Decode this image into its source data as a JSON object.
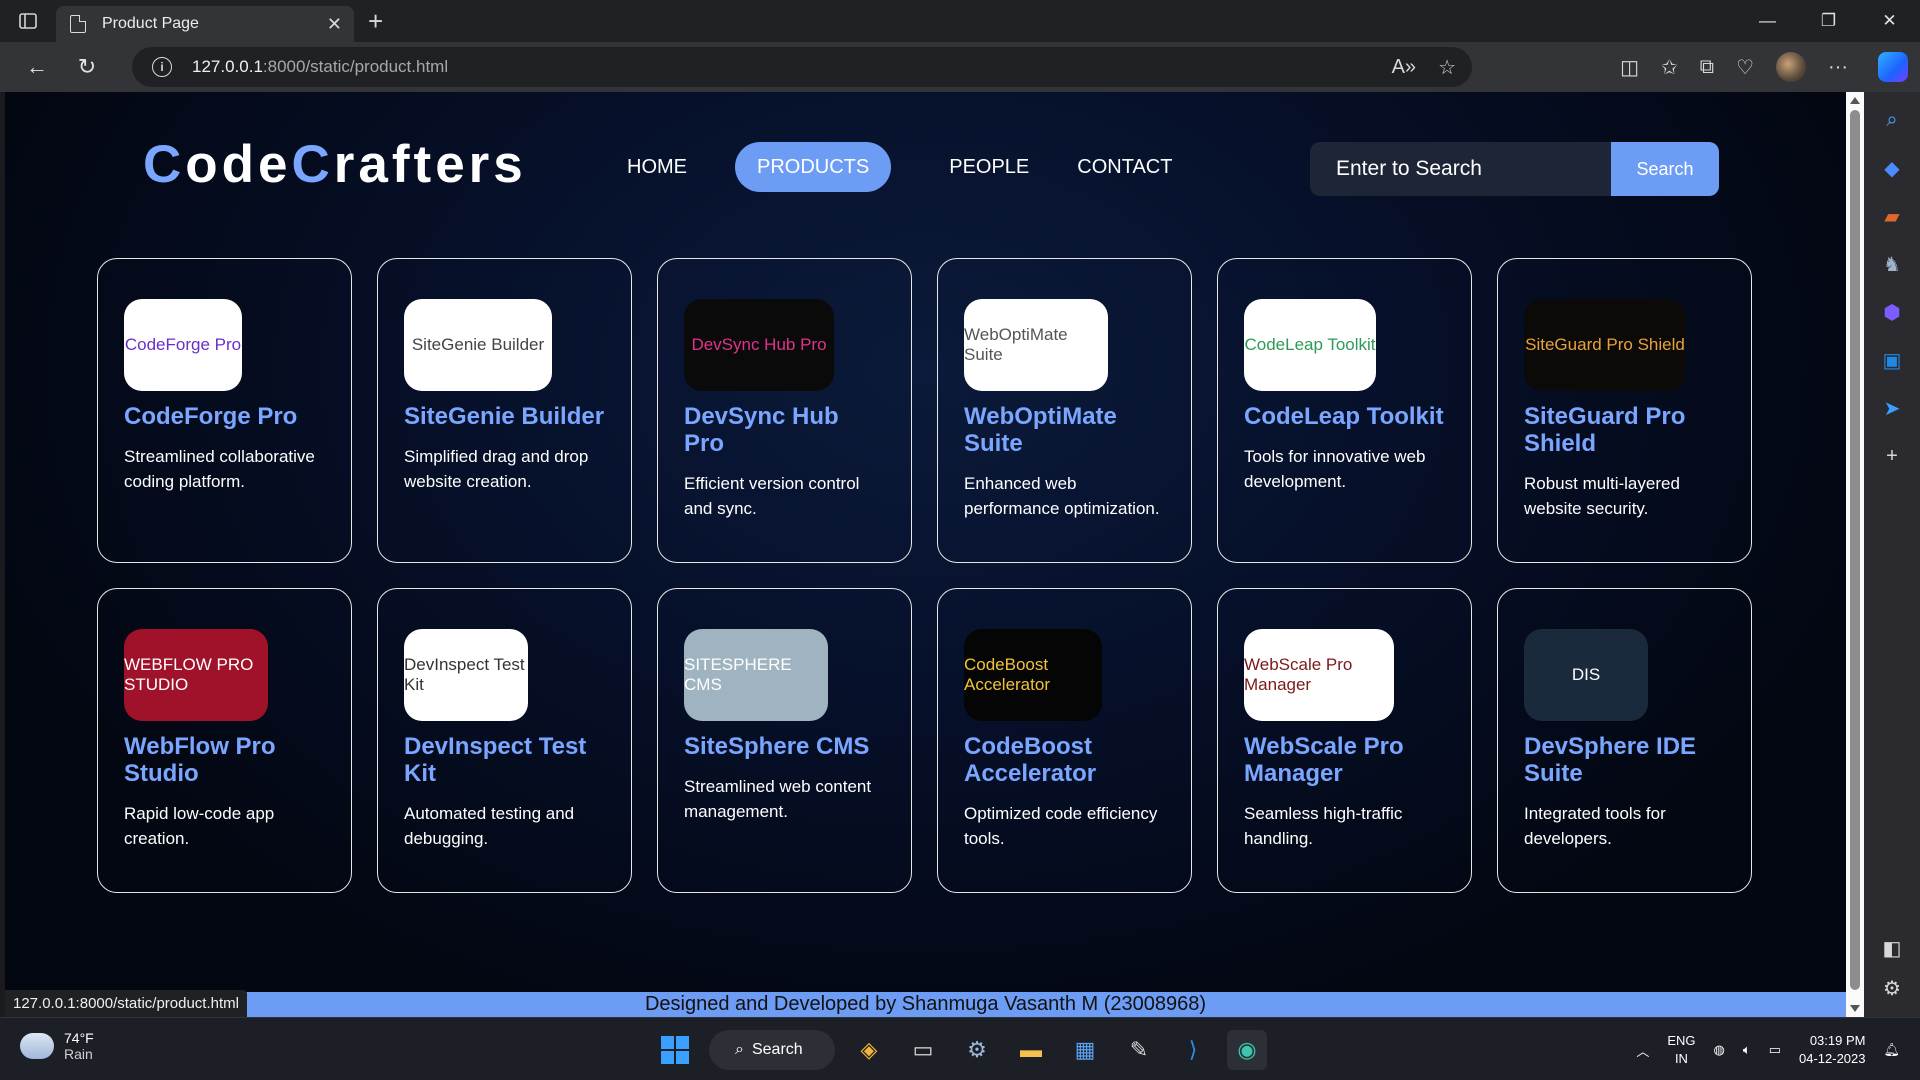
{
  "browser": {
    "tab_title": "Product Page",
    "url_host": "127.0.0.1",
    "url_rest": ":8000/static/product.html",
    "status_url": "127.0.0.1:8000/static/product.html"
  },
  "site": {
    "logo_parts": [
      "C",
      "ode",
      "C",
      "rafters"
    ],
    "nav": [
      {
        "label": "HOME",
        "active": false
      },
      {
        "label": "PRODUCTS",
        "active": true
      },
      {
        "label": "PEOPLE",
        "active": false
      },
      {
        "label": "CONTACT",
        "active": false
      }
    ],
    "search_placeholder": "Enter to Search",
    "search_button": "Search",
    "footer": "Designed and Developed by Shanmuga Vasanth M (23008968)"
  },
  "products": [
    {
      "name": "CodeForge Pro",
      "desc": "Streamlined collaborative coding platform.",
      "logo_text": "CodeForge Pro",
      "logo_bg": "#ffffff",
      "logo_fg": "#6b2fc9",
      "logo_w": 118
    },
    {
      "name": "SiteGenie Builder",
      "desc": "Simplified drag and drop website creation.",
      "logo_text": "SiteGenie Builder",
      "logo_bg": "#ffffff",
      "logo_fg": "#444444",
      "logo_w": 148
    },
    {
      "name": "DevSync Hub Pro",
      "desc": "Efficient version control and sync.",
      "logo_text": "DevSync Hub Pro",
      "logo_bg": "#0a0a0a",
      "logo_fg": "#e0338a",
      "logo_w": 150
    },
    {
      "name": "WebOptiMate Suite",
      "desc": "Enhanced web performance optimization.",
      "logo_text": "WebOptiMate Suite",
      "logo_bg": "#ffffff",
      "logo_fg": "#555555",
      "logo_w": 144
    },
    {
      "name": "CodeLeap Toolkit",
      "desc": "Tools for innovative web development.",
      "logo_text": "CodeLeap Toolkit",
      "logo_bg": "#ffffff",
      "logo_fg": "#2e9a5a",
      "logo_w": 132
    },
    {
      "name": "SiteGuard Pro Shield",
      "desc": "Robust multi-layered website security.",
      "logo_text": "SiteGuard Pro Shield",
      "logo_bg": "#0c0a08",
      "logo_fg": "#e8a13c",
      "logo_w": 162
    },
    {
      "name": "WebFlow Pro Studio",
      "desc": "Rapid low-code app creation.",
      "logo_text": "WEBFLOW PRO STUDIO",
      "logo_bg": "#a0122a",
      "logo_fg": "#ffffff",
      "logo_w": 144
    },
    {
      "name": "DevInspect Test Kit",
      "desc": "Automated testing and debugging.",
      "logo_text": "DevInspect Test Kit",
      "logo_bg": "#ffffff",
      "logo_fg": "#333333",
      "logo_w": 124
    },
    {
      "name": "SiteSphere CMS",
      "desc": "Streamlined web content management.",
      "logo_text": "SITESPHERE CMS",
      "logo_bg": "#9fb4c0",
      "logo_fg": "#ffffff",
      "logo_w": 144
    },
    {
      "name": "CodeBoost Accelerator",
      "desc": "Optimized code efficiency tools.",
      "logo_text": "CodeBoost Accelerator",
      "logo_bg": "#050505",
      "logo_fg": "#f0c33c",
      "logo_w": 138
    },
    {
      "name": "WebScale Pro Manager",
      "desc": "Seamless high-traffic handling.",
      "logo_text": "WebScale Pro Manager",
      "logo_bg": "#ffffff",
      "logo_fg": "#7a1a1a",
      "logo_w": 150
    },
    {
      "name": "DevSphere IDE Suite",
      "desc": "Integrated tools for developers.",
      "logo_text": "DIS",
      "logo_bg": "#1a2a3c",
      "logo_fg": "#ffffff",
      "logo_w": 124
    }
  ],
  "taskbar": {
    "temp": "74°F",
    "weather": "Rain",
    "search_label": "Search",
    "lang_1": "ENG",
    "lang_2": "IN",
    "time": "03:19 PM",
    "date": "04-12-2023"
  },
  "colors": {
    "accent": "#6d9cf5",
    "title": "#7aa6ff",
    "bg": "#030712"
  }
}
